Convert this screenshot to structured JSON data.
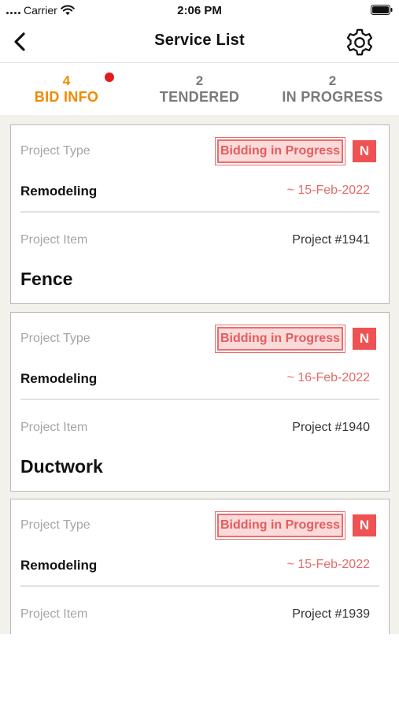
{
  "status_bar": {
    "carrier": "Carrier",
    "time": "2:06 PM"
  },
  "nav": {
    "title": "Service List",
    "back_icon": "chevron-left-icon",
    "settings_icon": "gear-icon"
  },
  "tabs": [
    {
      "count": "4",
      "label": "BID INFO",
      "active": true,
      "has_dot": true
    },
    {
      "count": "2",
      "label": "TENDERED",
      "active": false,
      "has_dot": false
    },
    {
      "count": "2",
      "label": "IN PROGRESS",
      "active": false,
      "has_dot": false
    }
  ],
  "labels": {
    "project_type": "Project Type",
    "project_item": "Project Item"
  },
  "cards": [
    {
      "status": "Bidding in Progress",
      "new_badge": "N",
      "type": "Remodeling",
      "date": "~ 15-Feb-2022",
      "project_no": "Project #1941",
      "item": "Fence"
    },
    {
      "status": "Bidding in Progress",
      "new_badge": "N",
      "type": "Remodeling",
      "date": "~ 16-Feb-2022",
      "project_no": "Project #1940",
      "item": "Ductwork"
    },
    {
      "status": "Bidding in Progress",
      "new_badge": "N",
      "type": "Remodeling",
      "date": "~ 15-Feb-2022",
      "project_no": "Project #1939",
      "item": ""
    }
  ],
  "colors": {
    "accent": "#f08a00",
    "status_red": "#e65c5c",
    "new_badge": "#ef5252",
    "list_bg": "#f2f1ec"
  }
}
